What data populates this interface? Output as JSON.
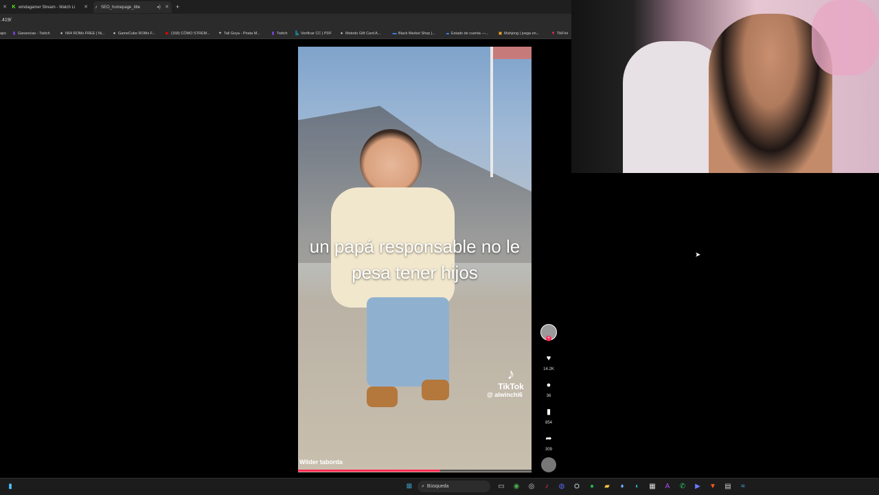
{
  "browser": {
    "tabs": [
      {
        "title": "windagamer Stream - Watch Li",
        "icon": "kick-icon",
        "glyph": "K",
        "color": "#53fc18"
      },
      {
        "title": "SEO_homepage_title",
        "icon": "tiktok-icon",
        "glyph": "♪",
        "color": "#ffffff"
      }
    ],
    "new_tab_label": "+",
    "url": ".419/",
    "bookmarks": [
      {
        "label": "aps",
        "icon": "",
        "color": "#cccccc"
      },
      {
        "label": "Ganancias - Twitch",
        "icon": "twitch-icon",
        "color": "#9146ff"
      },
      {
        "label": "N64 ROMs FREE | Ni...",
        "icon": "globe-icon",
        "color": "#cccccc"
      },
      {
        "label": "GameCube ROMs F...",
        "icon": "globe-icon",
        "color": "#cccccc"
      },
      {
        "label": "(168) CÓMO STREM...",
        "icon": "youtube-icon",
        "color": "#ff0000"
      },
      {
        "label": "Tali Goya - Pirata M...",
        "icon": "globe-icon",
        "color": "#cccccc"
      },
      {
        "label": "Twitch",
        "icon": "twitch-icon",
        "color": "#9146ff"
      },
      {
        "label": "Verificar CC | PDF",
        "icon": "scribd-icon",
        "color": "#1e7b85"
      },
      {
        "label": "Metodo Gift Card A...",
        "icon": "globe-icon",
        "color": "#cccccc"
      },
      {
        "label": "Black Market Shop |...",
        "icon": "shop-icon",
        "color": "#3b82f6"
      },
      {
        "label": "Estado de cuenta —...",
        "icon": "bank-icon",
        "color": "#3b82f6"
      },
      {
        "label": "Mahjong | juega en...",
        "icon": "game-icon",
        "color": "#f5a623"
      },
      {
        "label": "TikFini",
        "icon": "tikfinity-icon",
        "color": "#fe2c55"
      }
    ]
  },
  "video": {
    "caption": "un papá responsable no le pesa tener hijos",
    "brand": "TikTok",
    "handle": "@ alwinchi6",
    "author": "Wilder taborda",
    "progress": 0.61
  },
  "rail": {
    "likes": "14.2K",
    "comments": "36",
    "saves": "854",
    "shares": "309"
  },
  "taskbar": {
    "search_placeholder": "Búsqueda",
    "apps": [
      {
        "name": "task-view-icon",
        "glyph": "▭",
        "color": "#cccccc"
      },
      {
        "name": "chrome-icon",
        "glyph": "◉",
        "color": "#4caf50"
      },
      {
        "name": "obs-icon",
        "glyph": "◎",
        "color": "#cccccc"
      },
      {
        "name": "tiktok-studio-icon",
        "glyph": "♪",
        "color": "#fe2c55"
      },
      {
        "name": "discord-icon",
        "glyph": "◍",
        "color": "#5865f2"
      },
      {
        "name": "steam-icon",
        "glyph": "⛭",
        "color": "#c7d5e0"
      },
      {
        "name": "spotify-icon",
        "glyph": "●",
        "color": "#1db954"
      },
      {
        "name": "files-icon",
        "glyph": "▰",
        "color": "#f5c542"
      },
      {
        "name": "cheat-icon",
        "glyph": "♦",
        "color": "#6ea8ff"
      },
      {
        "name": "edge-icon",
        "glyph": "◐",
        "color": "#2bb5c8"
      },
      {
        "name": "calendar-icon",
        "glyph": "▦",
        "color": "#dddddd"
      },
      {
        "name": "streamlabs-icon",
        "glyph": "A",
        "color": "#b44dff"
      },
      {
        "name": "whatsapp-icon",
        "glyph": "✆",
        "color": "#25d366"
      },
      {
        "name": "video-editor-icon",
        "glyph": "▶",
        "color": "#6b7bff"
      },
      {
        "name": "brave-icon",
        "glyph": "▼",
        "color": "#ff5722"
      },
      {
        "name": "grid-app-icon",
        "glyph": "▤",
        "color": "#cccccc"
      },
      {
        "name": "network-icon",
        "glyph": "≈",
        "color": "#4cc2ff"
      }
    ]
  }
}
